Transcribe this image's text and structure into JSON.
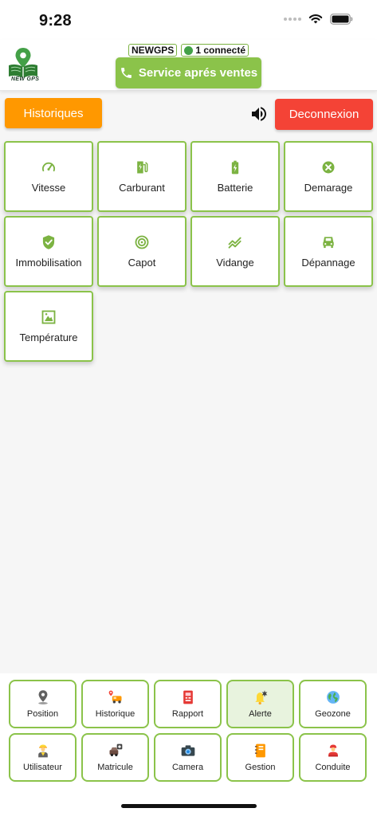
{
  "status_bar": {
    "time": "9:28"
  },
  "header": {
    "logo_text": "NEW GPS",
    "account_chip": "NEWGPS",
    "connected_chip": "1 connecté",
    "support_button": "Service aprés ventes"
  },
  "actions": {
    "history_button": "Historiques",
    "logout_button": "Deconnexion"
  },
  "tiles": [
    {
      "label": "Vitesse",
      "icon": "speedometer-icon"
    },
    {
      "label": "Carburant",
      "icon": "fuel-icon"
    },
    {
      "label": "Batterie",
      "icon": "battery-charging-icon"
    },
    {
      "label": "Demarage",
      "icon": "cancel-circle-icon"
    },
    {
      "label": "Immobilisation",
      "icon": "shield-check-icon"
    },
    {
      "label": "Capot",
      "icon": "target-icon"
    },
    {
      "label": "Vidange",
      "icon": "trend-icon"
    },
    {
      "label": "Dépannage",
      "icon": "car-service-icon"
    },
    {
      "label": "Température",
      "icon": "temperature-frame-icon"
    }
  ],
  "bottom_nav": [
    {
      "label": "Position",
      "icon": "map-pin-icon",
      "active": false
    },
    {
      "label": "Historique",
      "icon": "route-history-icon",
      "active": false
    },
    {
      "label": "Rapport",
      "icon": "report-icon",
      "active": false
    },
    {
      "label": "Alerte",
      "icon": "bell-alert-icon",
      "active": true
    },
    {
      "label": "Geozone",
      "icon": "globe-icon",
      "active": false
    },
    {
      "label": "Utilisateur",
      "icon": "user-worker-icon",
      "active": false
    },
    {
      "label": "Matricule",
      "icon": "vehicle-plate-icon",
      "active": false
    },
    {
      "label": "Camera",
      "icon": "camera-icon",
      "active": false
    },
    {
      "label": "Gestion",
      "icon": "notebook-icon",
      "active": false
    },
    {
      "label": "Conduite",
      "icon": "driver-icon",
      "active": false
    }
  ],
  "colors": {
    "accent_green": "#8bc34a",
    "history_orange": "#ff9800",
    "logout_red": "#f44336",
    "online_dot": "#43a047"
  }
}
